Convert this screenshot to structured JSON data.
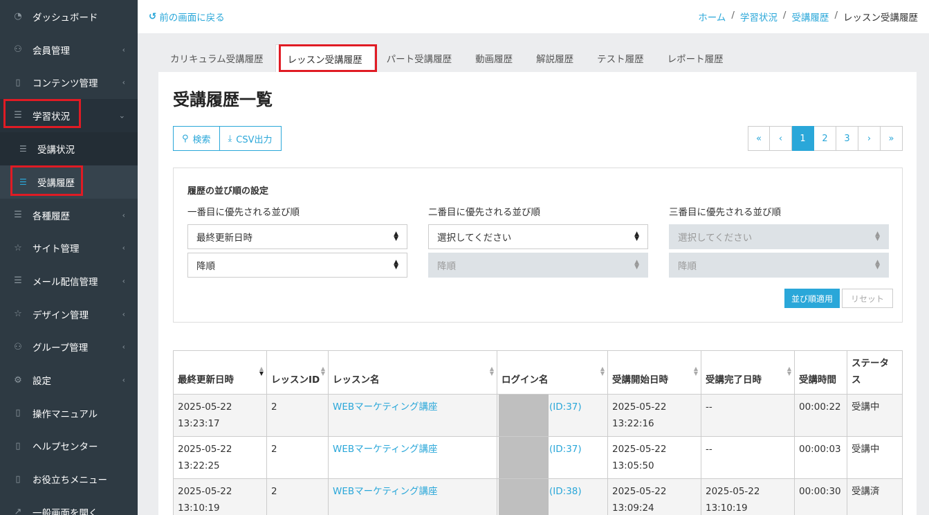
{
  "sidebar": {
    "items": [
      {
        "label": "ダッシュボード",
        "icon": "dashboard-icon",
        "chevron": false
      },
      {
        "label": "会員管理",
        "icon": "users-icon",
        "chevron": true
      },
      {
        "label": "コンテンツ管理",
        "icon": "book-icon",
        "chevron": true
      },
      {
        "label": "学習状況",
        "icon": "list-icon",
        "chevron": true,
        "open": true
      },
      {
        "label": "各種履歴",
        "icon": "list-icon",
        "chevron": true
      },
      {
        "label": "サイト管理",
        "icon": "star-icon",
        "chevron": true
      },
      {
        "label": "メール配信管理",
        "icon": "list-icon",
        "chevron": true
      },
      {
        "label": "デザイン管理",
        "icon": "star-icon",
        "chevron": true
      },
      {
        "label": "グループ管理",
        "icon": "users-icon",
        "chevron": true
      },
      {
        "label": "設定",
        "icon": "gear-icon",
        "chevron": true
      },
      {
        "label": "操作マニュアル",
        "icon": "book-icon",
        "chevron": false
      },
      {
        "label": "ヘルプセンター",
        "icon": "book-icon",
        "chevron": false
      },
      {
        "label": "お役立ちメニュー",
        "icon": "book-icon",
        "chevron": false
      },
      {
        "label": "一般画面を開く",
        "icon": "external-icon",
        "chevron": false
      }
    ],
    "sub_items": [
      {
        "label": "受講状況"
      },
      {
        "label": "受講履歴",
        "active": true
      }
    ]
  },
  "topbar": {
    "back": "前の画面に戻る",
    "breadcrumb": [
      "ホーム",
      "学習状況",
      "受講履歴",
      "レッスン受講履歴"
    ]
  },
  "tabs": [
    "カリキュラム受講履歴",
    "レッスン受講履歴",
    "パート受講履歴",
    "動画履歴",
    "解説履歴",
    "テスト履歴",
    "レポート履歴"
  ],
  "page_title": "受講履歴一覧",
  "buttons": {
    "search": "検索",
    "csv": "CSV出力"
  },
  "pager": [
    "«",
    "‹",
    "1",
    "2",
    "3",
    "›",
    "»"
  ],
  "sort": {
    "title": "履歴の並び順の設定",
    "col1_label": "一番目に優先される並び順",
    "col2_label": "二番目に優先される並び順",
    "col3_label": "三番目に優先される並び順",
    "col1_field": "最終更新日時",
    "col1_order": "降順",
    "col2_field": "選択してください",
    "col2_order": "降順",
    "col3_field": "選択してください",
    "col3_order": "降順",
    "apply": "並び順適用",
    "reset": "リセット"
  },
  "table": {
    "headers": [
      "最終更新日時",
      "レッスンID",
      "レッスン名",
      "ログイン名",
      "受講開始日時",
      "受講完了日時",
      "受講時間",
      "ステータス"
    ],
    "rows": [
      {
        "updated": "2025-05-22 13:23:17",
        "lesson_id": "2",
        "lesson_name": "WEBマーケティング講座",
        "login": "(ID:37)",
        "start": "2025-05-22 13:22:16",
        "end": "--",
        "duration": "00:00:22",
        "status": "受講中"
      },
      {
        "updated": "2025-05-22 13:22:25",
        "lesson_id": "2",
        "lesson_name": "WEBマーケティング講座",
        "login": "(ID:37)",
        "start": "2025-05-22 13:05:50",
        "end": "--",
        "duration": "00:00:03",
        "status": "受講中"
      },
      {
        "updated": "2025-05-22 13:10:19",
        "lesson_id": "2",
        "lesson_name": "WEBマーケティング講座",
        "login": "(ID:38)",
        "start": "2025-05-22 13:09:24",
        "end": "2025-05-22 13:10:19",
        "duration": "00:00:30",
        "status": "受講済"
      }
    ]
  }
}
